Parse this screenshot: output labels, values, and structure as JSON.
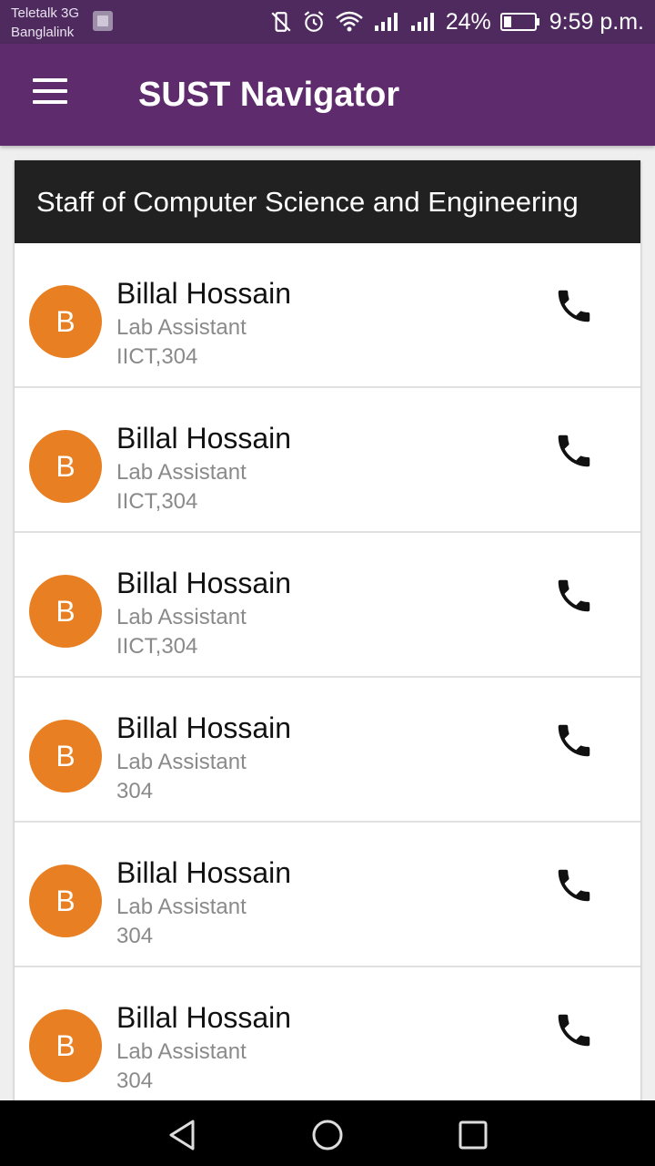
{
  "status_bar": {
    "carrier_1": "Teletalk 3G",
    "carrier_2": "Banglalink",
    "battery": "24%",
    "time": "9:59 p.m.",
    "icons": [
      "image-notification-icon",
      "vibrate-off-icon",
      "alarm-icon",
      "wifi-icon",
      "signal-icon",
      "signal-icon",
      "battery-icon"
    ]
  },
  "app_bar": {
    "title": "SUST Navigator",
    "menu_icon": "hamburger-menu-icon",
    "color": "#5e2b6d"
  },
  "card": {
    "header": "Staff of Computer Science and Engineering",
    "items": [
      {
        "initial": "B",
        "name": "Billal Hossain",
        "role": "Lab Assistant",
        "room": "IICT,304"
      },
      {
        "initial": "B",
        "name": "Billal Hossain",
        "role": "Lab Assistant",
        "room": "IICT,304"
      },
      {
        "initial": "B",
        "name": "Billal Hossain",
        "role": "Lab Assistant",
        "room": "IICT,304"
      },
      {
        "initial": "B",
        "name": "Billal Hossain",
        "role": "Lab Assistant",
        "room": "304"
      },
      {
        "initial": "B",
        "name": "Billal Hossain",
        "role": "Lab Assistant",
        "room": "304"
      },
      {
        "initial": "B",
        "name": "Billal Hossain",
        "role": "Lab Assistant",
        "room": "304"
      }
    ],
    "avatar_color": "#e87f22",
    "action_icon": "phone-icon"
  },
  "nav_bar": {
    "buttons": [
      "back-icon",
      "home-icon",
      "recents-icon"
    ]
  }
}
